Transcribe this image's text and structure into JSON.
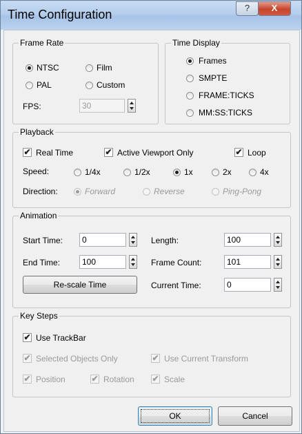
{
  "window": {
    "title": "Time Configuration",
    "help_glyph": "?",
    "close_glyph": "X"
  },
  "frame_rate": {
    "legend": "Frame Rate",
    "ntsc": "NTSC",
    "film": "Film",
    "pal": "PAL",
    "custom": "Custom",
    "fps_label": "FPS:",
    "fps_value": "30"
  },
  "time_display": {
    "legend": "Time Display",
    "frames": "Frames",
    "smpte": "SMPTE",
    "frame_ticks": "FRAME:TICKS",
    "mm_ss_ticks": "MM:SS:TICKS"
  },
  "playback": {
    "legend": "Playback",
    "real_time": "Real Time",
    "active_viewport_only": "Active Viewport Only",
    "loop": "Loop",
    "speed_label": "Speed:",
    "speeds": [
      "1/4x",
      "1/2x",
      "1x",
      "2x",
      "4x"
    ],
    "speed_selected": "1x",
    "direction_label": "Direction:",
    "directions": [
      "Forward",
      "Reverse",
      "Ping-Pong"
    ],
    "direction_selected": "Forward"
  },
  "animation": {
    "legend": "Animation",
    "start_time_label": "Start Time:",
    "start_time": "0",
    "end_time_label": "End Time:",
    "end_time": "100",
    "length_label": "Length:",
    "length": "100",
    "frame_count_label": "Frame Count:",
    "frame_count": "101",
    "current_time_label": "Current Time:",
    "current_time": "0",
    "rescale_label": "Re-scale Time"
  },
  "key_steps": {
    "legend": "Key Steps",
    "use_trackbar": "Use TrackBar",
    "selected_objects_only": "Selected Objects Only",
    "use_current_transform": "Use Current Transform",
    "position": "Position",
    "rotation": "Rotation",
    "scale": "Scale"
  },
  "buttons": {
    "ok": "OK",
    "cancel": "Cancel"
  },
  "check_glyph": "✔"
}
